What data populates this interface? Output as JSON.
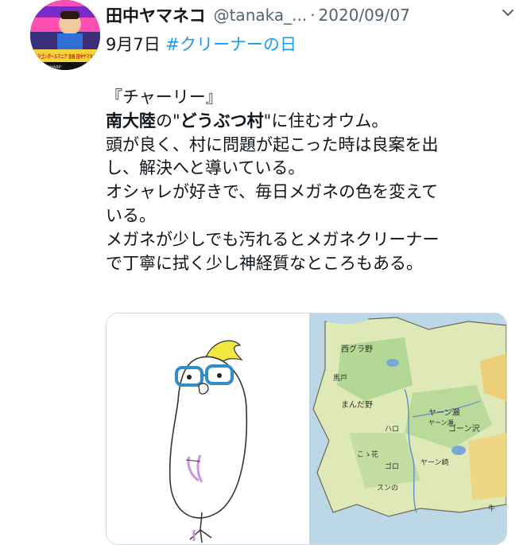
{
  "author": {
    "display_name": "田中ヤマネコ",
    "handle": "@tanaka_...",
    "separator": "·",
    "date": "2020/09/07",
    "avatar_banner_text": "ドラゴンボールマニア 会長 田中ヤマネコ",
    "avatar_tv_brand": "SHARP"
  },
  "tweet": {
    "first_line": "9月7日",
    "hashtag": "#クリーナーの日",
    "lines": [
      {
        "bold": "",
        "text": "『チャーリー』"
      },
      {
        "bold": "南大陸",
        "text": "の\"",
        "bold2": "どうぶつ村",
        "text2": "\"に住むオウム。"
      },
      {
        "bold": "",
        "text": "頭が良く、村に問題が起こった時は良案を出"
      },
      {
        "bold": "",
        "text": "し、解決へと導いている。"
      },
      {
        "bold": "",
        "text": "オシャレが好きで、毎日メガネの色を変えて"
      },
      {
        "bold": "",
        "text": "いる。"
      },
      {
        "bold": "",
        "text": "メガネが少しでも汚れるとメガネクリーナー"
      },
      {
        "bold": "",
        "text": "で丁寧に拭く少し神経質なところもある。"
      }
    ]
  },
  "media": {
    "left_image": "parrot-with-glasses-illustration",
    "right_image": "hand-drawn-map",
    "map_labels": [
      "西グラ野",
      "ヤーン瀬",
      "ヤーン瀬",
      "まんだ野",
      "馬戸",
      "ハロ",
      "ゴーン沢",
      "ゴロ",
      "こゝ花",
      "スンの",
      "ヤーン崎",
      "牛"
    ]
  },
  "icons": {
    "more": "chevron-down-icon"
  },
  "colors": {
    "link": "#1d9bf0",
    "secondary_text": "#536471",
    "glasses": "#2f8fc4",
    "parrot_crest": "#f2e640",
    "parrot_feet": "#c994e0"
  }
}
